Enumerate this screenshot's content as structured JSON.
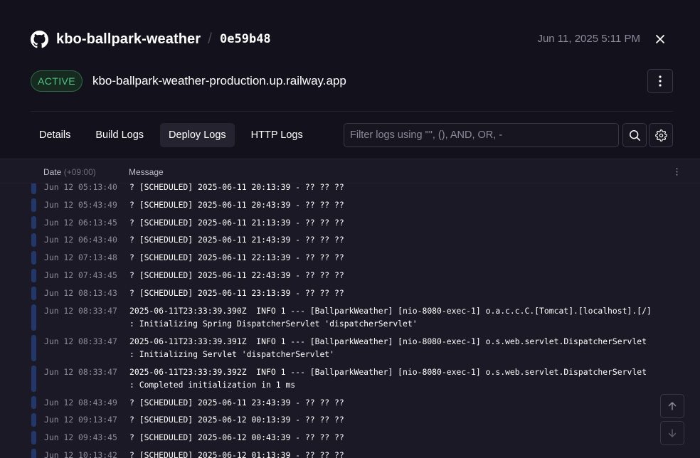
{
  "header": {
    "icon": "github-icon",
    "service_name": "kbo-ballpark-weather",
    "separator": "/",
    "commit_hash": "0e59b48",
    "timestamp": "Jun 11, 2025 5:11 PM"
  },
  "deployment": {
    "status": "ACTIVE",
    "domain": "kbo-ballpark-weather-production.up.railway.app"
  },
  "tabs": [
    {
      "label": "Details",
      "active": false
    },
    {
      "label": "Build Logs",
      "active": false
    },
    {
      "label": "Deploy Logs",
      "active": true
    },
    {
      "label": "HTTP Logs",
      "active": false
    }
  ],
  "filter": {
    "placeholder": "Filter logs using \"\", (), AND, OR, -",
    "value": ""
  },
  "table": {
    "date_header": "Date",
    "timezone": "(+09:00)",
    "message_header": "Message"
  },
  "logs": [
    {
      "date": "Jun 12 05:13:40",
      "message": "? [SCHEDULED] 2025-06-11 20:13:39 - ?? ?? ??"
    },
    {
      "date": "Jun 12 05:43:49",
      "message": "? [SCHEDULED] 2025-06-11 20:43:39 - ?? ?? ??"
    },
    {
      "date": "Jun 12 06:13:45",
      "message": "? [SCHEDULED] 2025-06-11 21:13:39 - ?? ?? ??"
    },
    {
      "date": "Jun 12 06:43:40",
      "message": "? [SCHEDULED] 2025-06-11 21:43:39 - ?? ?? ??"
    },
    {
      "date": "Jun 12 07:13:48",
      "message": "? [SCHEDULED] 2025-06-11 22:13:39 - ?? ?? ??"
    },
    {
      "date": "Jun 12 07:43:45",
      "message": "? [SCHEDULED] 2025-06-11 22:43:39 - ?? ?? ??"
    },
    {
      "date": "Jun 12 08:13:43",
      "message": "? [SCHEDULED] 2025-06-11 23:13:39 - ?? ?? ??"
    },
    {
      "date": "Jun 12 08:33:47",
      "message": "2025-06-11T23:33:39.390Z  INFO 1 --- [BallparkWeather] [nio-8080-exec-1] o.a.c.c.C.[Tomcat].[localhost].[/]\n: Initializing Spring DispatcherServlet 'dispatcherServlet'"
    },
    {
      "date": "Jun 12 08:33:47",
      "message": "2025-06-11T23:33:39.391Z  INFO 1 --- [BallparkWeather] [nio-8080-exec-1] o.s.web.servlet.DispatcherServlet\n: Initializing Servlet 'dispatcherServlet'"
    },
    {
      "date": "Jun 12 08:33:47",
      "message": "2025-06-11T23:33:39.392Z  INFO 1 --- [BallparkWeather] [nio-8080-exec-1] o.s.web.servlet.DispatcherServlet\n: Completed initialization in 1 ms"
    },
    {
      "date": "Jun 12 08:43:49",
      "message": "? [SCHEDULED] 2025-06-11 23:43:39 - ?? ?? ??"
    },
    {
      "date": "Jun 12 09:13:47",
      "message": "? [SCHEDULED] 2025-06-12 00:13:39 - ?? ?? ??"
    },
    {
      "date": "Jun 12 09:43:45",
      "message": "? [SCHEDULED] 2025-06-12 00:43:39 - ?? ?? ??"
    },
    {
      "date": "Jun 12 10:13:42",
      "message": "? [SCHEDULED] 2025-06-12 01:13:39 - ?? ?? ??"
    }
  ],
  "icons": {
    "close": "close-icon",
    "more": "more-vertical-icon",
    "search": "search-icon",
    "settings": "gear-icon",
    "scroll_top": "arrow-up-icon",
    "scroll_bottom": "arrow-down-icon"
  },
  "colors": {
    "background": "#13111c",
    "log_panel": "#1b1925",
    "active_badge": "#4ec584",
    "log_marker": "#22386a"
  }
}
